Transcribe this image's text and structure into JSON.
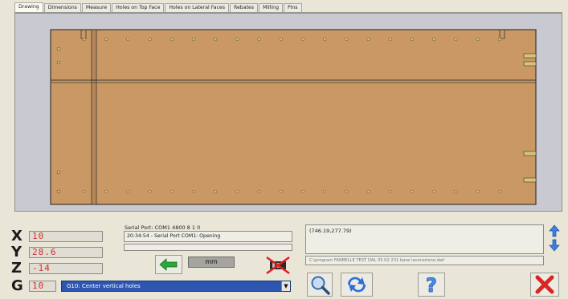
{
  "tabs": [
    {
      "label": "Drawing",
      "active": true
    },
    {
      "label": "Dimensions",
      "active": false
    },
    {
      "label": "Measure",
      "active": false
    },
    {
      "label": "Holes on Top Face",
      "active": false
    },
    {
      "label": "Holes on Lateral Faces",
      "active": false
    },
    {
      "label": "Rebates",
      "active": false
    },
    {
      "label": "Milling",
      "active": false
    },
    {
      "label": "Pins",
      "active": false
    }
  ],
  "coordinates": {
    "x": {
      "label": "X",
      "value": "10"
    },
    "y": {
      "label": "Y",
      "value": "28.6"
    },
    "z": {
      "label": "Z",
      "value": "-14"
    }
  },
  "serial": {
    "port_label": "Serial Port: COM1 4800 8 1 0",
    "log": "20:34:54 - Serial Port COM1: Opening"
  },
  "units": {
    "label": "mm"
  },
  "gcode": {
    "label": "G",
    "value": "10",
    "selected_option": "G10: Center vertical holes"
  },
  "cursor_coords": "(746.19,277.79)",
  "file_path": "C:\\program FANBELLE TEST DAL 35 02 231 base lavorazione.dwf",
  "icons": {
    "back": "green-left-arrow-icon",
    "serial_off": "serial-disconnected-icon",
    "zoom": "magnifier-icon",
    "refresh": "refresh-icon",
    "help": "question-mark-icon",
    "close": "red-x-icon",
    "scroll_up": "blue-up-arrow-icon",
    "scroll_down": "blue-down-arrow-icon"
  },
  "colors": {
    "panel": "#c99865",
    "panel_edge": "#3e372d",
    "hole": "#d9c27a",
    "value_red": "#d43030",
    "select_blue": "#2d56b0",
    "viewport": "#c9c9d2"
  }
}
